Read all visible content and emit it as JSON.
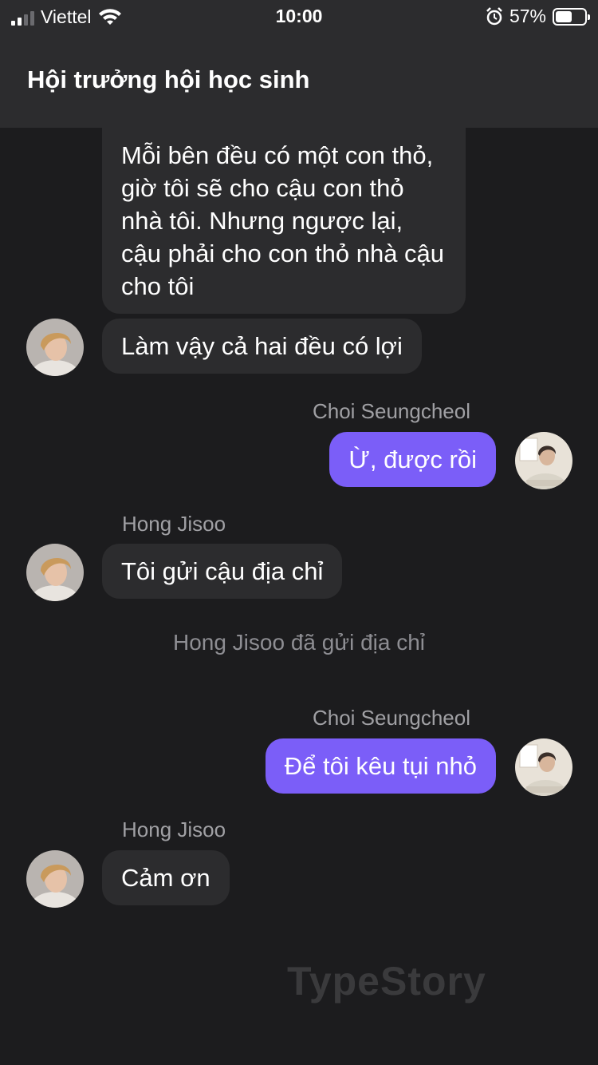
{
  "status_bar": {
    "carrier": "Viettel",
    "time": "10:00",
    "battery_percent": "57%",
    "battery_level": 0.57
  },
  "header": {
    "title": "Hội trưởng hội học sinh"
  },
  "messages": [
    {
      "text": "Mỗi bên đều có một con thỏ, giờ tôi sẽ cho cậu con thỏ nhà tôi. Nhưng ngược lại, cậu phải cho con thỏ nhà cậu cho tôi"
    },
    {
      "text": "Làm vậy cả hai đều có lợi"
    },
    {
      "sender": "Choi Seungcheol",
      "text": "Ừ, được rồi"
    },
    {
      "sender": "Hong Jisoo",
      "text": "Tôi gửi cậu địa chỉ"
    },
    {
      "system": "Hong Jisoo đã gửi địa chỉ"
    },
    {
      "sender": "Choi Seungcheol",
      "text": "Để tôi kêu tụi nhỏ"
    },
    {
      "sender": "Hong Jisoo",
      "text": "Cảm ơn"
    }
  ],
  "watermark": "TypeStory",
  "colors": {
    "background": "#1c1c1e",
    "incoming_bubble": "#2c2c2e",
    "outgoing_bubble": "#7b5ef8"
  }
}
